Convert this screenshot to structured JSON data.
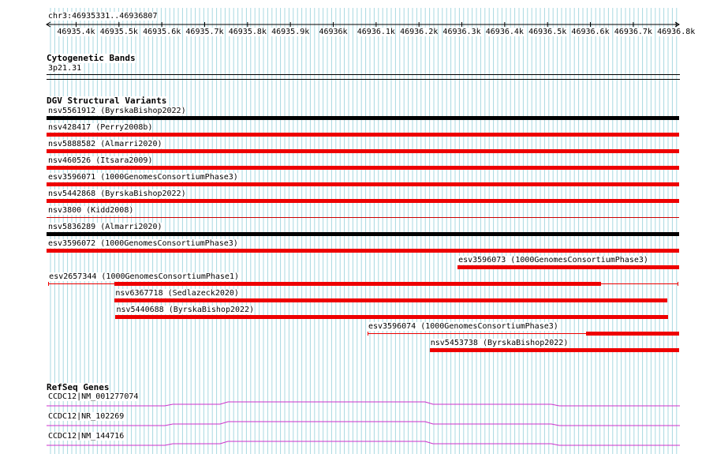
{
  "coordinate_label": "chr3:46935331..46936807",
  "ruler": {
    "ticks": [
      "46935.4k",
      "46935.5k",
      "46935.6k",
      "46935.7k",
      "46935.8k",
      "46935.9k",
      "46936k",
      "46936.1k",
      "46936.2k",
      "46936.3k",
      "46936.4k",
      "46936.5k",
      "46936.6k",
      "46936.7k",
      "46936.8k"
    ]
  },
  "cytoband_track": {
    "title": "Cytogenetic Bands",
    "band": "3p21.31"
  },
  "dgv_track": {
    "title": "DGV Structural Variants",
    "features": [
      {
        "label": "nsv5561912 (ByrskaBishop2022)",
        "color": "#000000",
        "start": 46935331,
        "end": 46936807
      },
      {
        "label": "nsv428417 (Perry2008b)",
        "color": "#ee0000",
        "start": 46935331,
        "end": 46936807
      },
      {
        "label": "nsv5888582 (Almarri2020)",
        "color": "#ee0000",
        "start": 46935331,
        "end": 46936807
      },
      {
        "label": "nsv460526 (Itsara2009)",
        "color": "#ee0000",
        "start": 46935331,
        "end": 46936807
      },
      {
        "label": "esv3596071 (1000GenomesConsortiumPhase3)",
        "color": "#ee0000",
        "start": 46935331,
        "end": 46936807
      },
      {
        "label": "nsv5442868 (ByrskaBishop2022)",
        "color": "#ee0000",
        "start": 46935331,
        "end": 46936807
      },
      {
        "label": "nsv3800 (Kidd2008)",
        "color": "#cc0000",
        "start": 46935331,
        "end": 46936807,
        "thin": true
      },
      {
        "label": "nsv5836289 (Almarri2020)",
        "color": "#000000",
        "start": 46935331,
        "end": 46936807
      },
      {
        "label": "esv3596072 (1000GenomesConsortiumPhase3)",
        "color": "#ee0000",
        "start": 46935331,
        "end": 46936807
      },
      {
        "label": "esv3596073 (1000GenomesConsortiumPhase3)",
        "color": "#ee0000",
        "start": 46936290,
        "end": 46936807
      },
      {
        "label": "esv2657344 (1000GenomesConsortiumPhase1)",
        "color": "#ee0000",
        "start": 46935335,
        "end": 46936805,
        "thick_start": 46935490,
        "thick_end": 46936625
      },
      {
        "label": "nsv6367718 (Sedlazeck2020)",
        "color": "#ee0000",
        "start": 46935490,
        "end": 46936780
      },
      {
        "label": "nsv5440688 (ByrskaBishop2022)",
        "color": "#ee0000",
        "start": 46935492,
        "end": 46936782
      },
      {
        "label": "esv3596074 (1000GenomesConsortiumPhase3)",
        "color": "#ee0000",
        "start": 46936080,
        "end": 46936807,
        "thick_start": 46936590,
        "thick_end": 46936807
      },
      {
        "label": "nsv5453738 (ByrskaBishop2022)",
        "color": "#ee0000",
        "start": 46936225,
        "end": 46936807
      }
    ]
  },
  "refseq_track": {
    "title": "RefSeq Genes",
    "color": "#cc33cc",
    "genes": [
      "CCDC12|NM_001277074",
      "CCDC12|NR_102269",
      "CCDC12|NM_144716"
    ]
  }
}
